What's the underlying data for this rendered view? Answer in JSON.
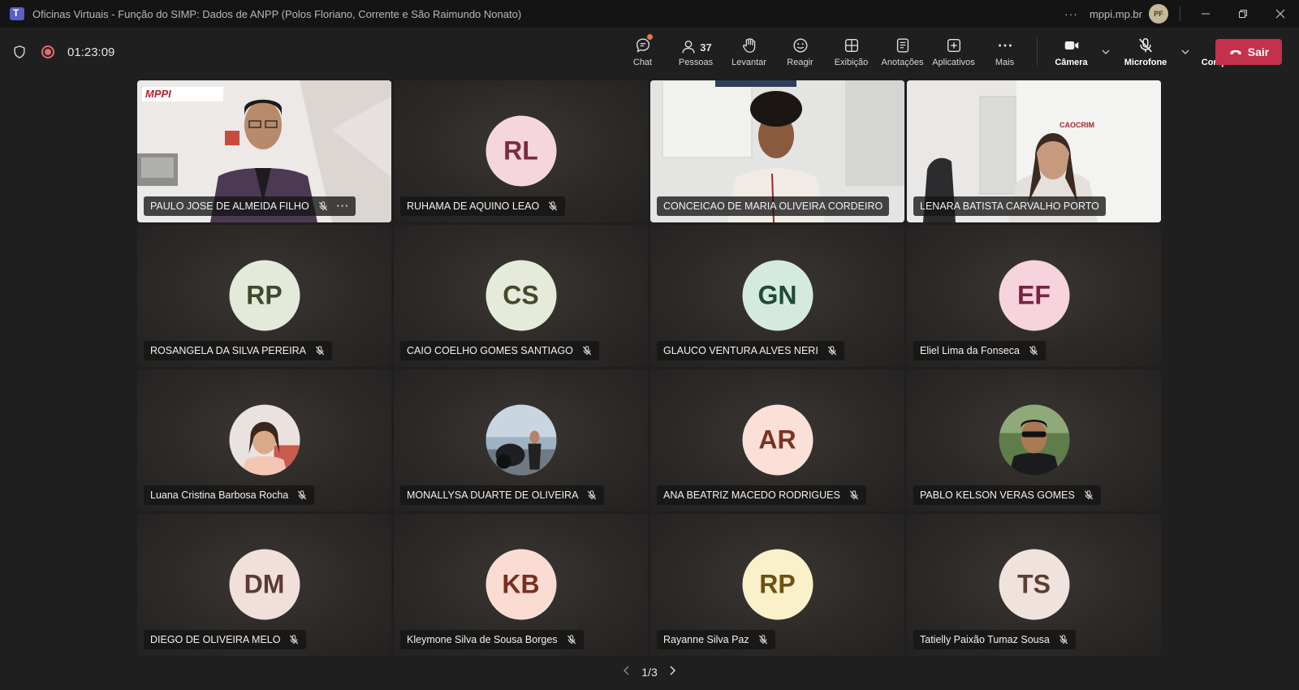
{
  "window": {
    "title": "Oficinas Virtuais - Função do SIMP: Dados de ANPP (Polos Floriano, Corrente e São Raimundo Nonato)",
    "org": "mppi.mp.br",
    "user_initials": "PF"
  },
  "meeting": {
    "timer": "01:23:09",
    "people_count": "37"
  },
  "toolbar": {
    "chat": "Chat",
    "people": "Pessoas",
    "raise": "Levantar",
    "react": "Reagir",
    "view": "Exibição",
    "notes": "Anotações",
    "apps": "Aplicativos",
    "more": "Mais",
    "camera": "Câmera",
    "mic": "Microfone",
    "share": "Compartilhar",
    "leave": "Sair"
  },
  "participants": [
    {
      "name": "PAULO JOSE DE ALMEIDA FILHO",
      "type": "video"
    },
    {
      "name": "RUHAMA DE AQUINO LEAO",
      "initials": "RL",
      "bg": "#f6d6de",
      "fg": "#7a2b3d"
    },
    {
      "name": "CONCEICAO DE MARIA OLIVEIRA CORDEIRO",
      "type": "video"
    },
    {
      "name": "LENARA BATISTA CARVALHO PORTO",
      "type": "video"
    },
    {
      "name": "ROSANGELA DA SILVA PEREIRA",
      "initials": "RP",
      "bg": "#e3ead9",
      "fg": "#3d4a2c"
    },
    {
      "name": "CAIO COELHO GOMES SANTIAGO",
      "initials": "CS",
      "bg": "#e6ead8",
      "fg": "#44492c"
    },
    {
      "name": "GLAUCO VENTURA ALVES NERI",
      "initials": "GN",
      "bg": "#d5eadf",
      "fg": "#1f4a36"
    },
    {
      "name": "Eliel Lima da Fonseca",
      "initials": "EF",
      "bg": "#f7d3dd",
      "fg": "#7a2340"
    },
    {
      "name": "Luana Cristina Barbosa Rocha",
      "type": "photo"
    },
    {
      "name": "MONALLYSA DUARTE DE OLIVEIRA",
      "type": "photo"
    },
    {
      "name": "ANA BEATRIZ MACEDO RODRIGUES",
      "initials": "AR",
      "bg": "#fbe0d8",
      "fg": "#7a3322"
    },
    {
      "name": "PABLO KELSON VERAS GOMES",
      "type": "photo"
    },
    {
      "name": "DIEGO DE OLIVEIRA MELO",
      "initials": "DM",
      "bg": "#f1dfdb",
      "fg": "#5a3a33"
    },
    {
      "name": "Kleymone Silva de Sousa Borges",
      "initials": "KB",
      "bg": "#fbdcd3",
      "fg": "#7a2e1f"
    },
    {
      "name": "Rayanne Silva Paz",
      "initials": "RP",
      "bg": "#faf0c9",
      "fg": "#6b5113"
    },
    {
      "name": "Tatielly Paixão Tumaz Sousa",
      "initials": "TS",
      "bg": "#f0e2dd",
      "fg": "#5b3f35"
    }
  ],
  "video_text": {
    "logo": "MPPI",
    "caocrim": "CAOCRIM"
  },
  "pager": {
    "label": "1/3"
  }
}
